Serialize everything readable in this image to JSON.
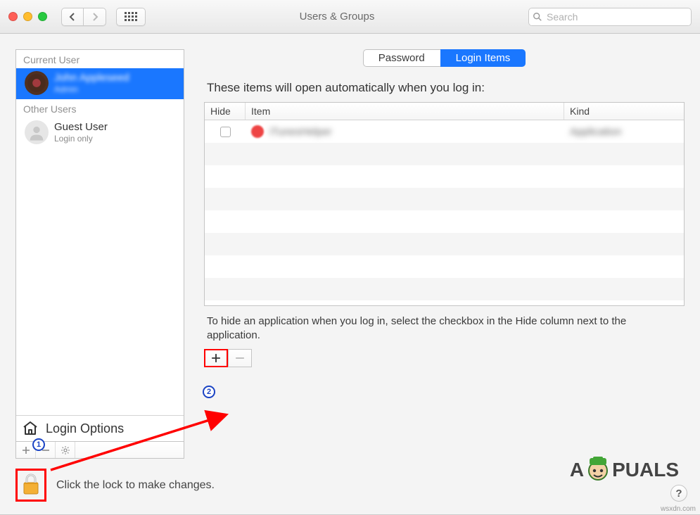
{
  "window": {
    "title": "Users & Groups",
    "search_placeholder": "Search"
  },
  "sidebar": {
    "section_current": "Current User",
    "section_other": "Other Users",
    "current_user": {
      "name": "John Appleseed",
      "role": "Admin"
    },
    "other_users": [
      {
        "name": "Guest User",
        "role": "Login only"
      }
    ],
    "login_options_label": "Login Options"
  },
  "main": {
    "tabs": {
      "password": "Password",
      "login_items": "Login Items",
      "active": "login_items"
    },
    "description": "These items will open automatically when you log in:",
    "columns": {
      "hide": "Hide",
      "item": "Item",
      "kind": "Kind"
    },
    "items": [
      {
        "hide": false,
        "name": "iTunesHelper",
        "kind": "Application"
      }
    ],
    "hide_hint": "To hide an application when you log in, select the checkbox in the Hide column next to the application.",
    "add_label": "+",
    "remove_label": "−"
  },
  "footer": {
    "lock_message": "Click the lock to make changes."
  },
  "annotations": {
    "step1": "1",
    "step2": "2"
  },
  "attribution": "wsxdn.com",
  "watermark": {
    "prefix": "A",
    "suffix": "PUALS"
  }
}
